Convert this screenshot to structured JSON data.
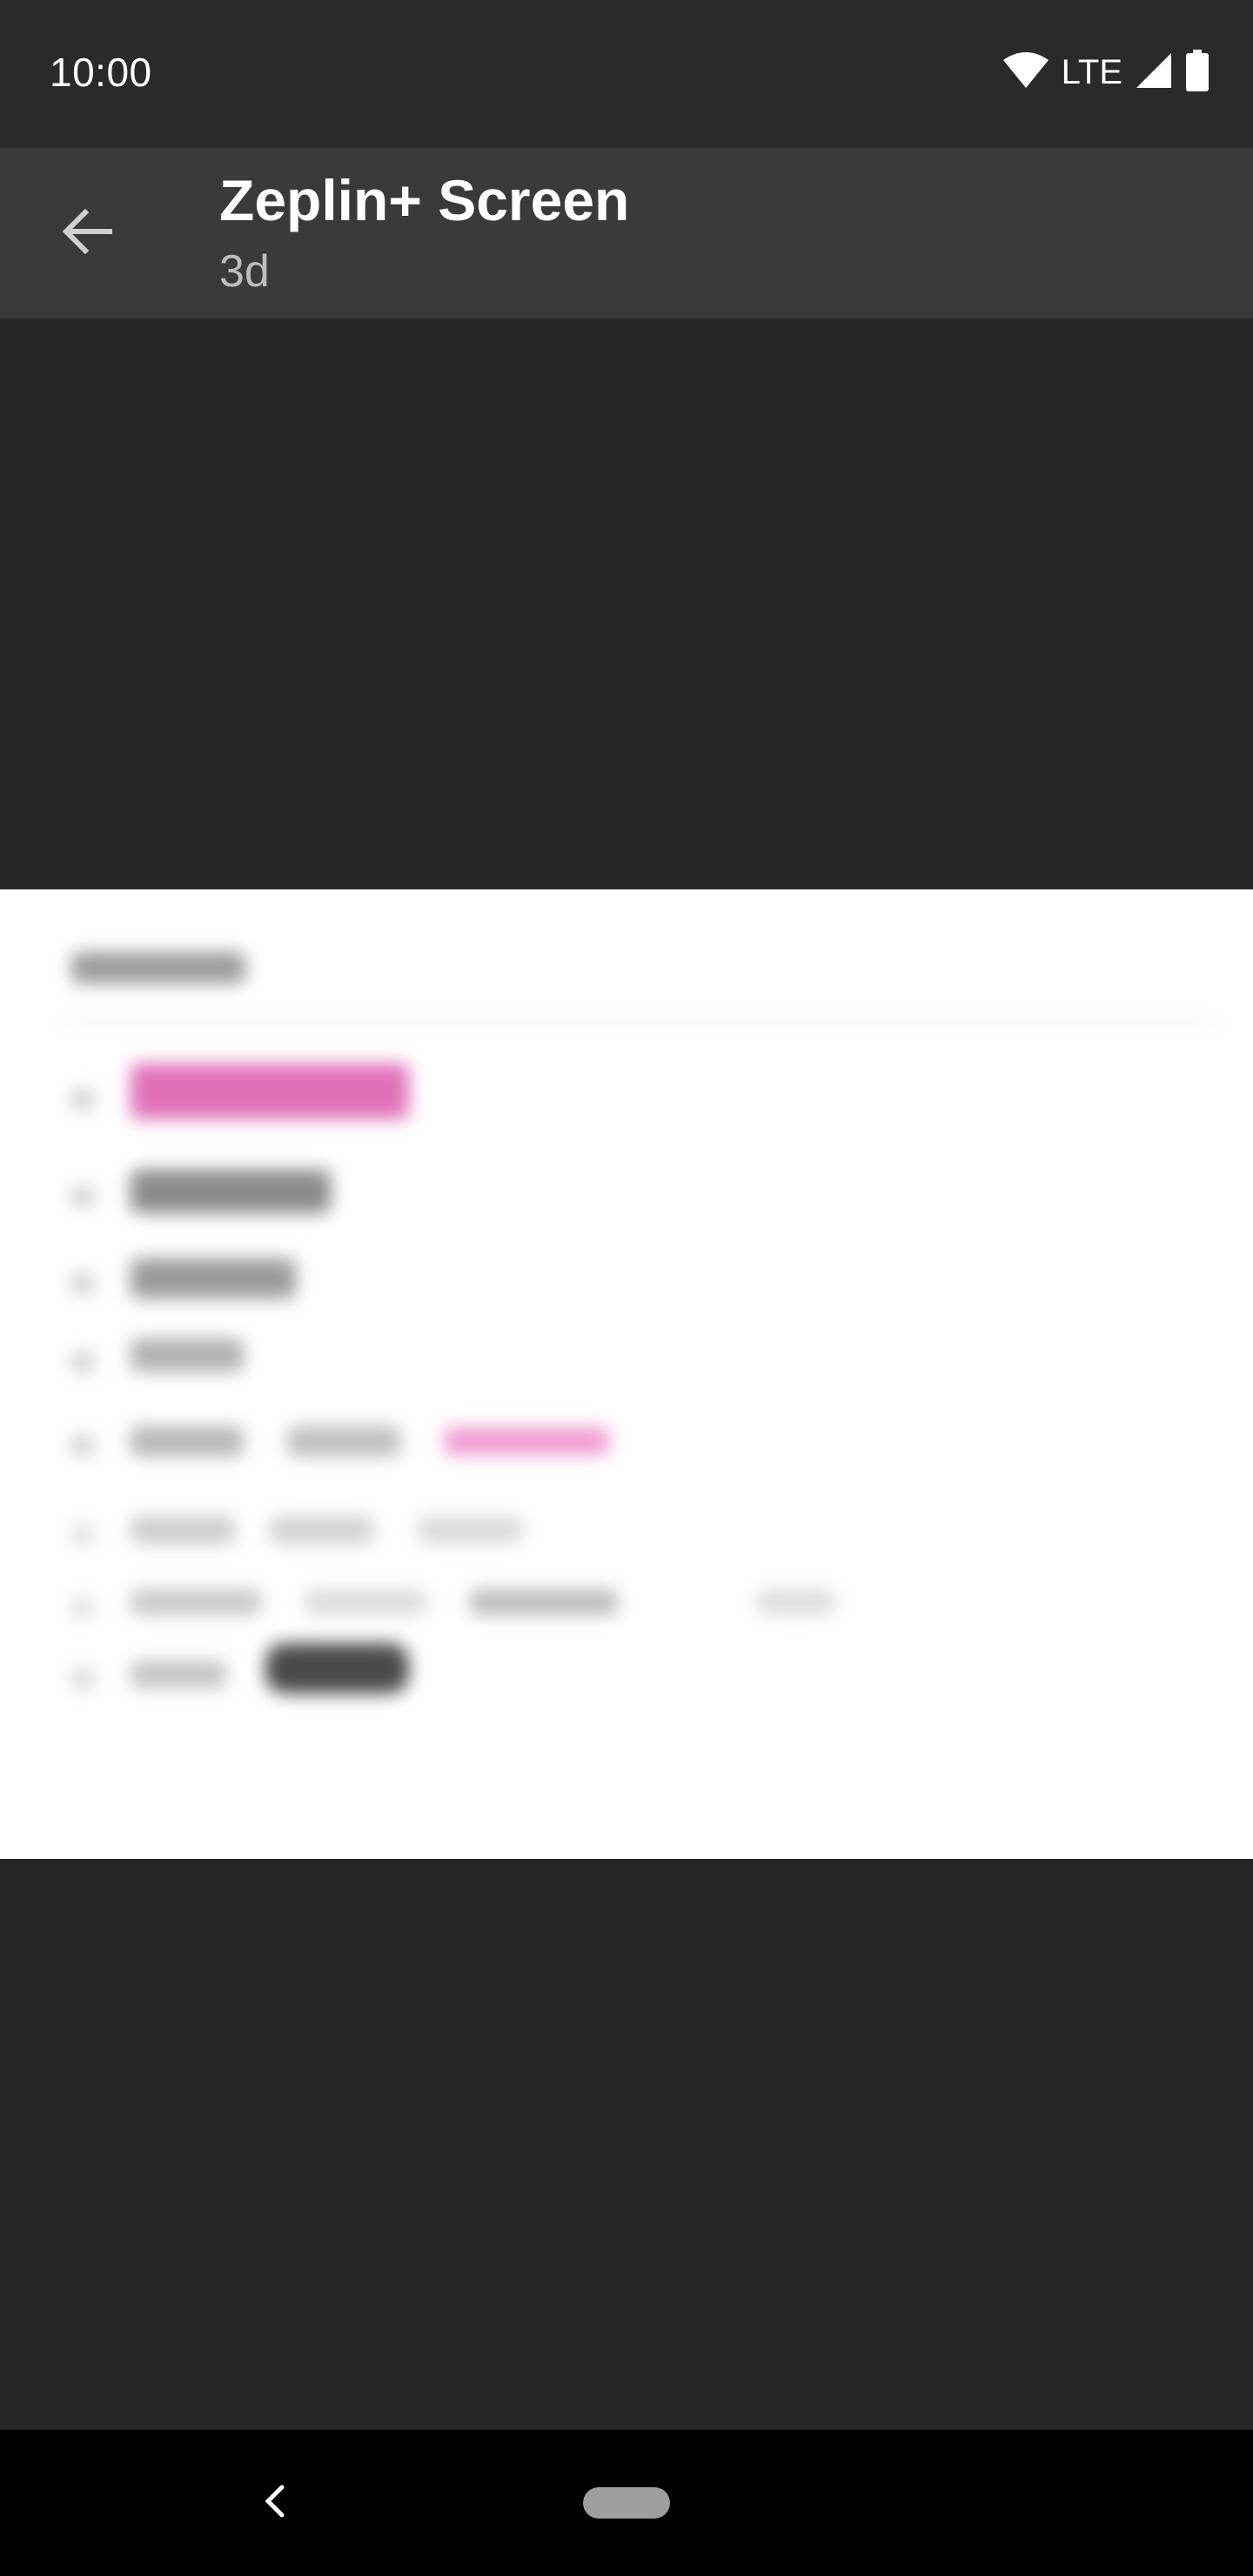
{
  "status_bar": {
    "time": "10:00",
    "network_label": "LTE",
    "icons": [
      "wifi-icon",
      "cell-signal-icon",
      "battery-icon"
    ]
  },
  "toolbar": {
    "title": "Zeplin+ Screen",
    "subtitle": "3d",
    "back_icon": "arrow-back-icon"
  },
  "preview": {
    "state": "blurred"
  },
  "nav_bar": {
    "icons": [
      "nav-back-icon",
      "home-pill"
    ]
  },
  "colors": {
    "background": "#262626",
    "toolbar": "#3a3a3a",
    "status_bar": "#2a2a2a",
    "preview_background": "#ffffff",
    "accent": "#e040a0"
  }
}
